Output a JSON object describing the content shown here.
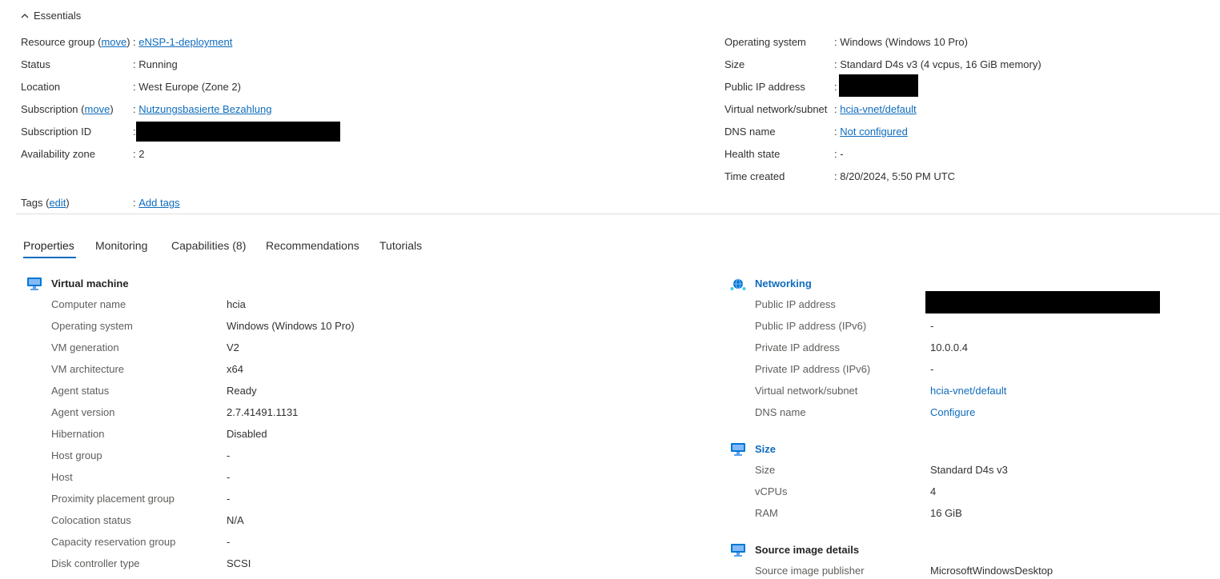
{
  "essentials": {
    "title": "Essentials",
    "left": [
      {
        "label": "Resource group",
        "edit": "move",
        "value": "eNSP-1-deployment",
        "link": true
      },
      {
        "label": "Status",
        "value": "Running"
      },
      {
        "label": "Location",
        "value": "West Europe (Zone 2)"
      },
      {
        "label": "Subscription",
        "edit": "move",
        "value": "Nutzungsbasierte Bezahlung",
        "link": true
      },
      {
        "label": "Subscription ID",
        "value": ""
      },
      {
        "label": "Availability zone",
        "value": "2"
      }
    ],
    "right": [
      {
        "label": "Operating system",
        "value": "Windows (Windows 10 Pro)"
      },
      {
        "label": "Size",
        "value": "Standard D4s v3 (4 vcpus, 16 GiB memory)"
      },
      {
        "label": "Public IP address",
        "value": ""
      },
      {
        "label": "Virtual network/subnet",
        "value": "hcia-vnet/default",
        "link": true
      },
      {
        "label": "DNS name",
        "value": "Not configured",
        "link": true
      },
      {
        "label": "Health state",
        "value": "-"
      },
      {
        "label": "Time created",
        "value": "8/20/2024, 5:50 PM UTC"
      }
    ],
    "tags": {
      "label": "Tags",
      "edit": "edit",
      "value": "Add tags"
    },
    "separator": ":",
    "paren_open": "(",
    "paren_close": ")"
  },
  "tabs": [
    "Properties",
    "Monitoring",
    "Capabilities (8)",
    "Recommendations",
    "Tutorials"
  ],
  "active_tab": "Properties",
  "vm_section": {
    "title": "Virtual machine",
    "icon": "monitor-icon",
    "rows": [
      {
        "label": "Computer name",
        "value": "hcia"
      },
      {
        "label": "Operating system",
        "value": "Windows (Windows 10 Pro)"
      },
      {
        "label": "VM generation",
        "value": "V2"
      },
      {
        "label": "VM architecture",
        "value": "x64"
      },
      {
        "label": "Agent status",
        "value": "Ready"
      },
      {
        "label": "Agent version",
        "value": "2.7.41491.1131"
      },
      {
        "label": "Hibernation",
        "value": "Disabled"
      },
      {
        "label": "Host group",
        "value": "-"
      },
      {
        "label": "Host",
        "value": "-"
      },
      {
        "label": "Proximity placement group",
        "value": "-"
      },
      {
        "label": "Colocation status",
        "value": "N/A"
      },
      {
        "label": "Capacity reservation group",
        "value": "-"
      },
      {
        "label": "Disk controller type",
        "value": "SCSI"
      }
    ]
  },
  "networking_section": {
    "title": "Networking",
    "icon": "network-globe-icon",
    "rows": [
      {
        "label": "Public IP address",
        "value": ""
      },
      {
        "label": "Public IP address (IPv6)",
        "value": "-"
      },
      {
        "label": "Private IP address",
        "value": "10.0.0.4"
      },
      {
        "label": "Private IP address (IPv6)",
        "value": "-"
      },
      {
        "label": "Virtual network/subnet",
        "value": "hcia-vnet/default",
        "link": true
      },
      {
        "label": "DNS name",
        "value": "Configure",
        "link": true
      }
    ]
  },
  "size_section": {
    "title": "Size",
    "icon": "monitor-icon",
    "rows": [
      {
        "label": "Size",
        "value": "Standard D4s v3"
      },
      {
        "label": "vCPUs",
        "value": "4"
      },
      {
        "label": "RAM",
        "value": "16 GiB"
      }
    ]
  },
  "source_image_section": {
    "title": "Source image details",
    "icon": "monitor-icon",
    "rows": [
      {
        "label": "Source image publisher",
        "value": "MicrosoftWindowsDesktop"
      }
    ]
  },
  "colors": {
    "link": "#0f6cbd",
    "text": "#323130",
    "label": "#605e5c",
    "divider": "#e1dfdd"
  }
}
